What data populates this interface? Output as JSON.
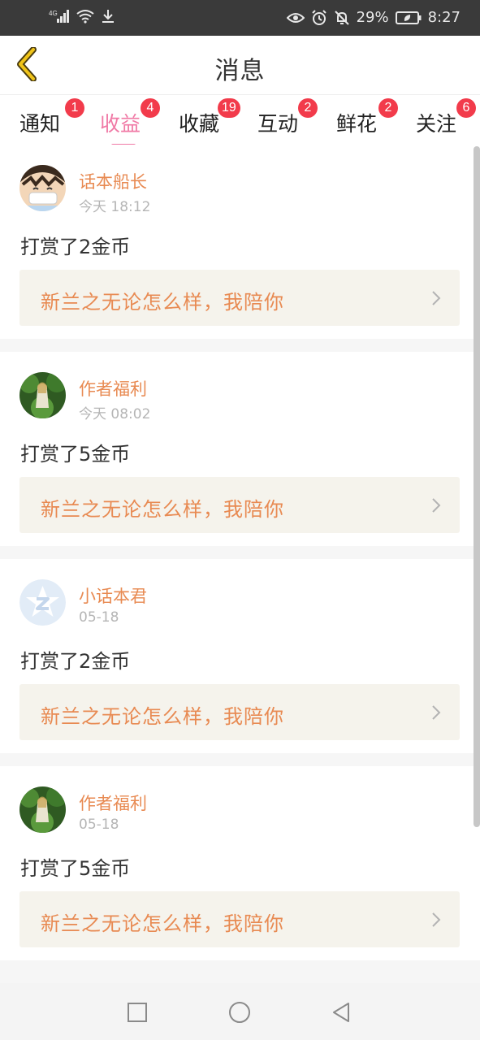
{
  "status_bar": {
    "network": "4G",
    "battery": "29%",
    "time": "8:27"
  },
  "header": {
    "title": "消息"
  },
  "tabs": [
    {
      "label": "通知",
      "badge": "1"
    },
    {
      "label": "收益",
      "badge": "4",
      "active": true
    },
    {
      "label": "收藏",
      "badge": "19"
    },
    {
      "label": "互动",
      "badge": "2"
    },
    {
      "label": "鲜花",
      "badge": "2"
    },
    {
      "label": "关注",
      "badge": "6"
    }
  ],
  "messages": [
    {
      "sender": "话本船长",
      "time": "今天 18:12",
      "text": "打赏了2金币",
      "link": "新兰之无论怎么样，我陪你",
      "avatar": "cartoon-avatar"
    },
    {
      "sender": "作者福利",
      "time": "今天 08:02",
      "text": "打赏了5金币",
      "link": "新兰之无论怎么样，我陪你",
      "avatar": "forest-girl-avatar"
    },
    {
      "sender": "小话本君",
      "time": "05-18",
      "text": "打赏了2金币",
      "link": "新兰之无论怎么样，我陪你",
      "avatar": "z-star-logo-avatar"
    },
    {
      "sender": "作者福利",
      "time": "05-18",
      "text": "打赏了5金币",
      "link": "新兰之无论怎么样，我陪你",
      "avatar": "forest-girl-avatar"
    }
  ],
  "colors": {
    "accent_pink": "#f07aa6",
    "badge_red": "#f23b4b",
    "name_orange": "#e88a52",
    "link_bg": "#f5f3ec",
    "back_arrow_yellow": "#f0c419"
  }
}
